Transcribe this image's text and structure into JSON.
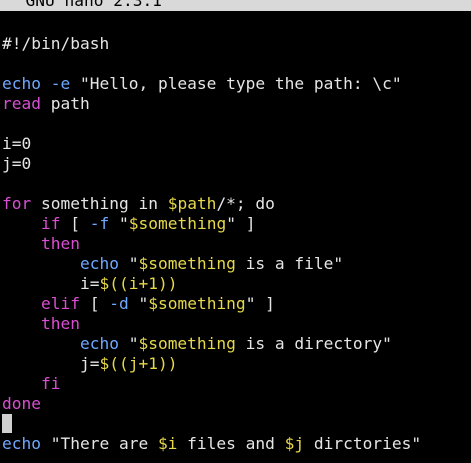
{
  "app": {
    "title": "  GNU nano 2.3.1"
  },
  "code": [
    {
      "id": "shebang",
      "parts": [
        {
          "t": "#!/bin/bash",
          "c": "plain"
        }
      ]
    },
    {
      "id": "blank1",
      "parts": []
    },
    {
      "id": "echo1",
      "parts": [
        {
          "t": "echo",
          "c": "echo"
        },
        {
          "t": " ",
          "c": "plain"
        },
        {
          "t": "-e",
          "c": "opt"
        },
        {
          "t": " \"Hello, please type the path: \\c\"",
          "c": "plain"
        }
      ]
    },
    {
      "id": "read",
      "parts": [
        {
          "t": "read",
          "c": "kw"
        },
        {
          "t": " path",
          "c": "plain"
        }
      ]
    },
    {
      "id": "blank2",
      "parts": []
    },
    {
      "id": "i0",
      "parts": [
        {
          "t": "i=0",
          "c": "plain"
        }
      ]
    },
    {
      "id": "j0",
      "parts": [
        {
          "t": "j=0",
          "c": "plain"
        }
      ]
    },
    {
      "id": "blank3",
      "parts": []
    },
    {
      "id": "for",
      "parts": [
        {
          "t": "for",
          "c": "kw"
        },
        {
          "t": " something in ",
          "c": "plain"
        },
        {
          "t": "$path",
          "c": "var"
        },
        {
          "t": "/*; do",
          "c": "plain"
        }
      ]
    },
    {
      "id": "if",
      "parts": [
        {
          "t": "    ",
          "c": "plain"
        },
        {
          "t": "if",
          "c": "kw"
        },
        {
          "t": " [ ",
          "c": "plain"
        },
        {
          "t": "-f",
          "c": "opt"
        },
        {
          "t": " \"",
          "c": "plain"
        },
        {
          "t": "$something",
          "c": "var"
        },
        {
          "t": "\" ]",
          "c": "plain"
        }
      ]
    },
    {
      "id": "then1",
      "parts": [
        {
          "t": "    ",
          "c": "plain"
        },
        {
          "t": "then",
          "c": "kw"
        }
      ]
    },
    {
      "id": "echo-file",
      "parts": [
        {
          "t": "        ",
          "c": "plain"
        },
        {
          "t": "echo",
          "c": "echo"
        },
        {
          "t": " \"",
          "c": "plain"
        },
        {
          "t": "$something",
          "c": "var"
        },
        {
          "t": " is a file\"",
          "c": "plain"
        }
      ]
    },
    {
      "id": "inc-i",
      "parts": [
        {
          "t": "        i=",
          "c": "plain"
        },
        {
          "t": "$((i+1))",
          "c": "var"
        }
      ]
    },
    {
      "id": "elif",
      "parts": [
        {
          "t": "    ",
          "c": "plain"
        },
        {
          "t": "elif",
          "c": "kw"
        },
        {
          "t": " [ ",
          "c": "plain"
        },
        {
          "t": "-d",
          "c": "opt"
        },
        {
          "t": " \"",
          "c": "plain"
        },
        {
          "t": "$something",
          "c": "var"
        },
        {
          "t": "\" ]",
          "c": "plain"
        }
      ]
    },
    {
      "id": "then2",
      "parts": [
        {
          "t": "    ",
          "c": "plain"
        },
        {
          "t": "then",
          "c": "kw"
        }
      ]
    },
    {
      "id": "echo-dir",
      "parts": [
        {
          "t": "        ",
          "c": "plain"
        },
        {
          "t": "echo",
          "c": "echo"
        },
        {
          "t": " \"",
          "c": "plain"
        },
        {
          "t": "$something",
          "c": "var"
        },
        {
          "t": " is a directory\"",
          "c": "plain"
        }
      ]
    },
    {
      "id": "inc-j",
      "parts": [
        {
          "t": "        j=",
          "c": "plain"
        },
        {
          "t": "$((j+1))",
          "c": "var"
        }
      ]
    },
    {
      "id": "fi",
      "parts": [
        {
          "t": "    ",
          "c": "plain"
        },
        {
          "t": "fi",
          "c": "kw"
        }
      ]
    },
    {
      "id": "done",
      "parts": [
        {
          "t": "done",
          "c": "kw"
        }
      ]
    },
    {
      "id": "cursor-line",
      "cursor": true,
      "parts": []
    },
    {
      "id": "echo-summary",
      "parts": [
        {
          "t": "echo",
          "c": "echo"
        },
        {
          "t": " \"There are ",
          "c": "plain"
        },
        {
          "t": "$i",
          "c": "var"
        },
        {
          "t": " files and ",
          "c": "plain"
        },
        {
          "t": "$j",
          "c": "var"
        },
        {
          "t": " dirctories\"",
          "c": "plain"
        }
      ]
    }
  ],
  "colors": {
    "background": "#000000",
    "titlebar": "#d9d9d9",
    "keyword": "#d94fd1",
    "string_var": "#e6d84a",
    "command_option": "#6fa8ff",
    "text": "#e5e5e5"
  }
}
